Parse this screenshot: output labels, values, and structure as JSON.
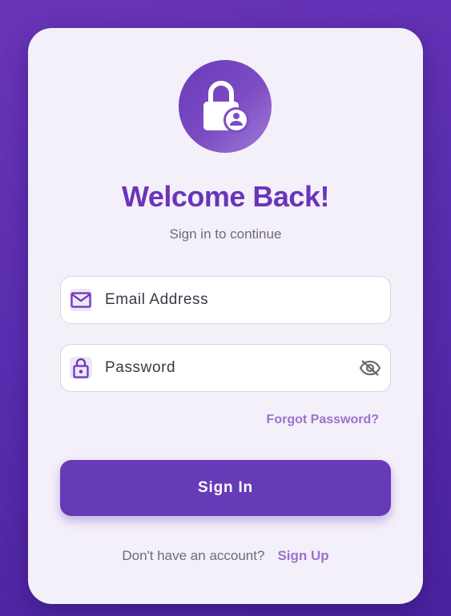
{
  "header": {
    "logo_icon": "lock-person-icon",
    "title": "Welcome Back!",
    "subtitle": "Sign in to continue"
  },
  "form": {
    "email": {
      "icon": "mail-icon",
      "placeholder": "Email Address",
      "value": ""
    },
    "password": {
      "icon": "lock-icon",
      "placeholder": "Password",
      "value": "",
      "toggle_icon": "visibility-off-icon"
    },
    "forgot_label": "Forgot Password?",
    "submit_label": "Sign In"
  },
  "footer": {
    "prompt": "Don't have an account?",
    "signup_label": "Sign Up"
  },
  "colors": {
    "primary": "#673ab7",
    "title": "#6a35b9",
    "link": "#9a72cf",
    "card_background": "#f4f0f9",
    "page_gradient_start": "#6a35b9",
    "page_gradient_end": "#4a22a0"
  }
}
